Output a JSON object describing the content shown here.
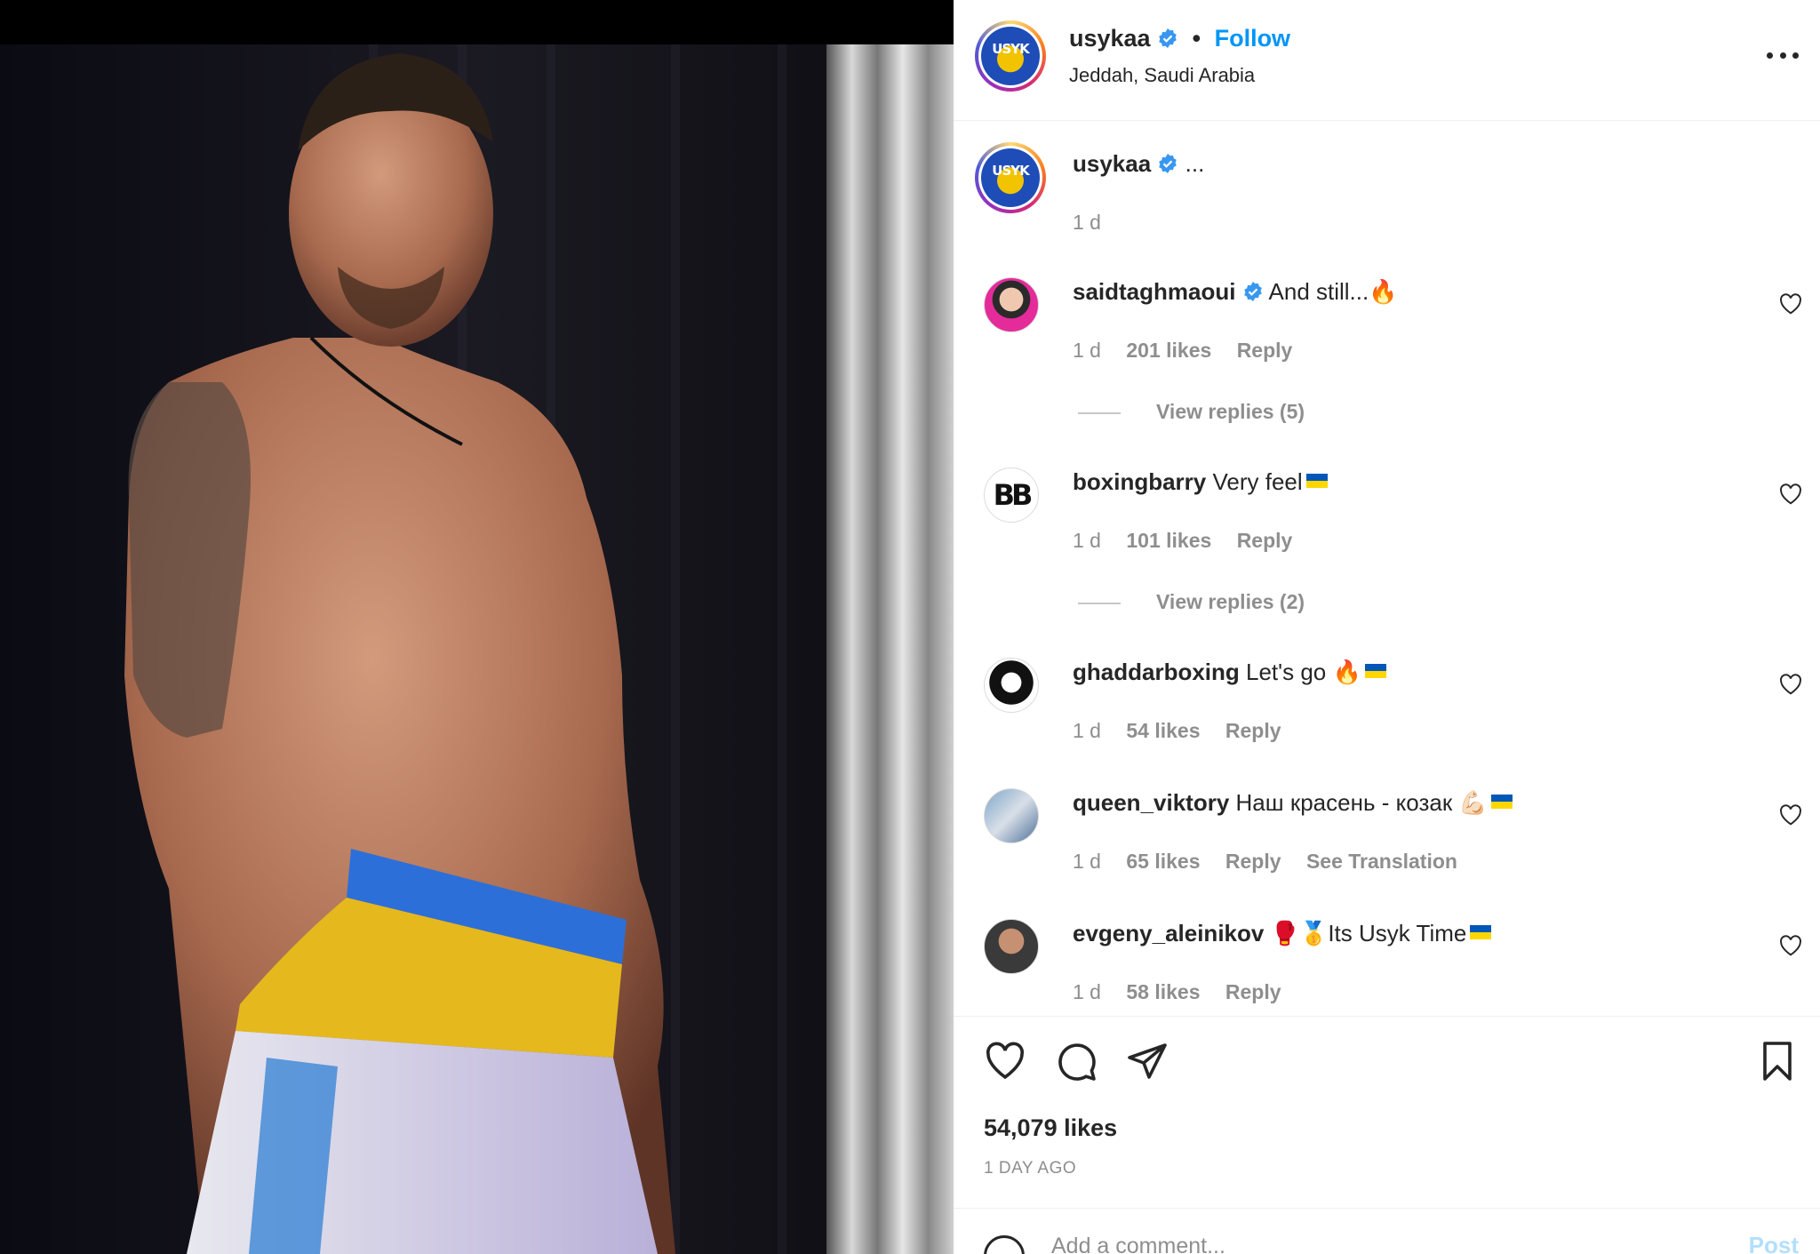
{
  "post": {
    "author": "usykaa",
    "follow_label": "Follow",
    "separator": "•",
    "location": "Jeddah, Saudi Arabia",
    "caption_text": "...",
    "caption_time": "1 d"
  },
  "comments": [
    {
      "user": "saidtaghmaoui",
      "verified": true,
      "text": "And still...🔥",
      "time": "1 d",
      "likes": "201 likes",
      "reply": "Reply",
      "view_replies": "View replies (5)"
    },
    {
      "user": "boxingbarry",
      "verified": false,
      "text": "Very feel",
      "flag": true,
      "time": "1 d",
      "likes": "101 likes",
      "reply": "Reply",
      "view_replies": "View replies (2)"
    },
    {
      "user": "ghaddarboxing",
      "verified": false,
      "text": "Let's go 🔥",
      "flag": true,
      "time": "1 d",
      "likes": "54 likes",
      "reply": "Reply"
    },
    {
      "user": "queen_viktory",
      "verified": false,
      "text": "Наш красень - козак 💪🏻",
      "flag": true,
      "time": "1 d",
      "likes": "65 likes",
      "reply": "Reply",
      "see_translation": "See Translation"
    },
    {
      "user": "evgeny_aleinikov",
      "verified": false,
      "text": "🥊🥇Its Usyk Time",
      "flag": true,
      "time": "1 d",
      "likes": "58 likes",
      "reply": "Reply"
    }
  ],
  "actions": {
    "like_count": "54,079 likes",
    "posted_ago": "1 DAY AGO"
  },
  "add_comment": {
    "placeholder": "Add a comment...",
    "post_label": "Post"
  },
  "colors": {
    "accent": "#0095f6",
    "verified": "#3897f0",
    "muted": "#8e8e8e",
    "flag_blue": "#0057b7",
    "flag_yellow": "#ffd700"
  },
  "icons": [
    "verified-badge-icon",
    "more-options-icon",
    "heart-icon",
    "comment-icon",
    "share-icon",
    "bookmark-icon",
    "emoji-icon"
  ]
}
